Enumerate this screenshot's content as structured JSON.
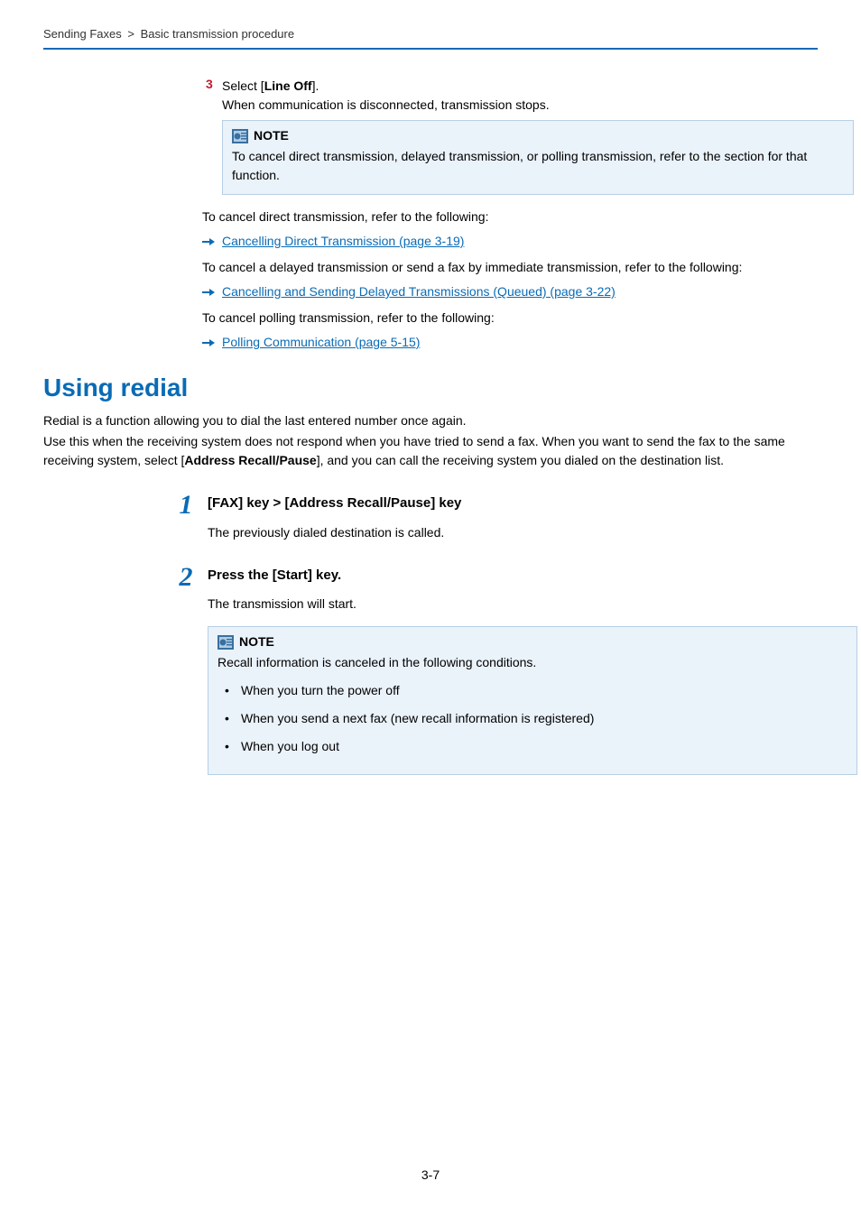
{
  "breadcrumb": {
    "part1": "Sending Faxes",
    "sep": ">",
    "part2": "Basic transmission procedure"
  },
  "step3": {
    "num": "3",
    "line1a": "Select [",
    "line1b": "Line Off",
    "line1c": "].",
    "line2": "When communication is disconnected, transmission stops."
  },
  "note1": {
    "label": "NOTE",
    "text": "To cancel direct transmission, delayed transmission, or polling transmission, refer to the section for that function."
  },
  "ref_intro1": "To cancel direct transmission, refer to the following:",
  "link1": "Cancelling Direct Transmission (page 3-19)",
  "ref_intro2": "To cancel a delayed transmission or send a fax by immediate transmission, refer to the following:",
  "link2": "Cancelling and Sending Delayed Transmissions (Queued) (page 3-22)",
  "ref_intro3": "To cancel polling transmission, refer to the following:",
  "link3": "Polling Communication (page 5-15)",
  "section_title": "Using redial",
  "para1": "Redial is a function allowing you to dial the last entered number once again.",
  "para2a": "Use this when the receiving system does not respond when you have tried to send a fax. When you want to send the fax to the same receiving system, select [",
  "para2b": "Address Recall/Pause",
  "para2c": "], and you can call the receiving system you dialed on the destination list.",
  "bigstep1": {
    "num": "1",
    "title": "[FAX] key > [Address Recall/Pause] key",
    "text": "The previously dialed destination is called."
  },
  "bigstep2": {
    "num": "2",
    "title": "Press the [Start] key.",
    "text": "The transmission will start."
  },
  "note2": {
    "label": "NOTE",
    "intro": "Recall information is canceled in the following conditions.",
    "bullets": [
      "When you turn the power off",
      "When you send a next fax (new recall information is registered)",
      "When you log out"
    ]
  },
  "page_number": "3-7"
}
